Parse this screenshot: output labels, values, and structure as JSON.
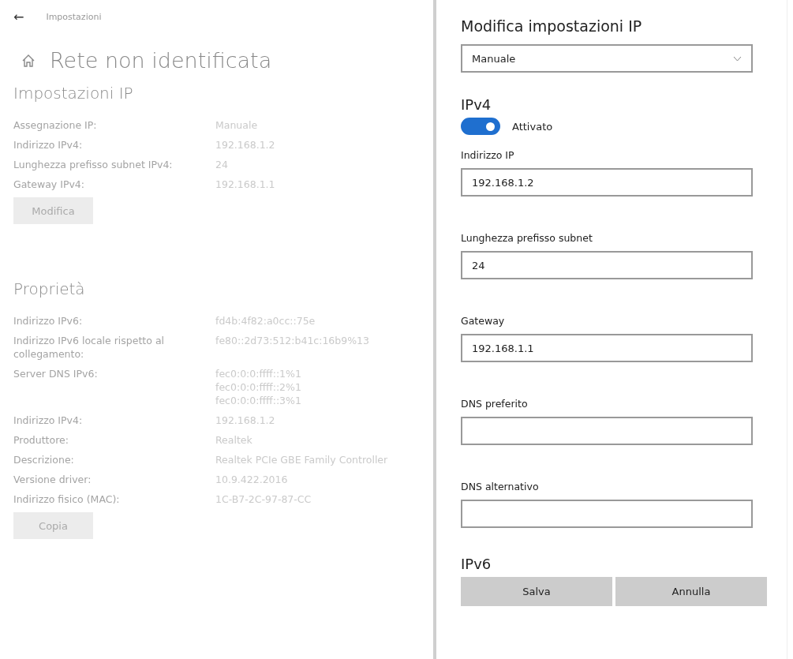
{
  "header": {
    "back": "←",
    "title": "Impostazioni"
  },
  "page_title": "Rete non identificata",
  "ip_settings": {
    "heading": "Impostazioni IP",
    "rows": [
      {
        "label": "Assegnazione IP:",
        "values": [
          "Manuale"
        ]
      },
      {
        "label": "Indirizzo IPv4:",
        "values": [
          "192.168.1.2"
        ]
      },
      {
        "label": "Lunghezza prefisso subnet IPv4:",
        "values": [
          "24"
        ]
      },
      {
        "label": "Gateway IPv4:",
        "values": [
          "192.168.1.1"
        ]
      }
    ],
    "button": "Modifica"
  },
  "properties": {
    "heading": "Proprietà",
    "rows": [
      {
        "label": "Indirizzo IPv6:",
        "values": [
          "fd4b:4f82:a0cc::75e"
        ]
      },
      {
        "label": "Indirizzo IPv6 locale rispetto al collegamento:",
        "values": [
          "fe80::2d73:512:b41c:16b9%13"
        ]
      },
      {
        "label": "Server DNS IPv6:",
        "values": [
          "fec0:0:0:ffff::1%1",
          "fec0:0:0:ffff::2%1",
          "fec0:0:0:ffff::3%1"
        ]
      },
      {
        "label": "Indirizzo IPv4:",
        "values": [
          "192.168.1.2"
        ]
      },
      {
        "label": "Produttore:",
        "values": [
          "Realtek"
        ]
      },
      {
        "label": "Descrizione:",
        "values": [
          "Realtek PCIe GBE Family Controller"
        ]
      },
      {
        "label": "Versione driver:",
        "values": [
          "10.9.422.2016"
        ]
      },
      {
        "label": "Indirizzo fisico (MAC):",
        "values": [
          "1C-B7-2C-97-87-CC"
        ]
      }
    ],
    "button": "Copia"
  },
  "dialog": {
    "title": "Modifica impostazioni IP",
    "mode": "Manuale",
    "ipv4": {
      "heading": "IPv4",
      "toggle": {
        "on": true,
        "label": "Attivato"
      },
      "fields": [
        {
          "label": "Indirizzo IP",
          "value": "192.168.1.2"
        },
        {
          "label": "Lunghezza prefisso subnet",
          "value": "24"
        },
        {
          "label": "Gateway",
          "value": "192.168.1.1"
        },
        {
          "label": "DNS preferito"
        },
        {
          "label": "DNS alternativo"
        }
      ]
    },
    "ipv6_heading": "IPv6",
    "buttons": [
      "Salva",
      "Annulla"
    ]
  }
}
